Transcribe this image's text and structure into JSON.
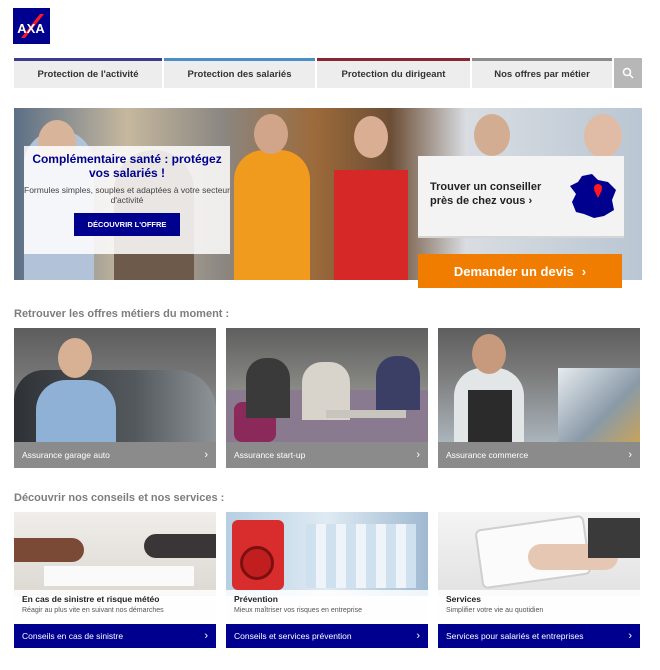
{
  "brand": {
    "logo_text": "AXA",
    "color": "#00008f",
    "accent": "#f07c00"
  },
  "nav": {
    "items": [
      {
        "label": "Protection de l'activité"
      },
      {
        "label": "Protection des salariés"
      },
      {
        "label": "Protection du dirigeant"
      },
      {
        "label": "Nos offres par métier"
      }
    ],
    "search_icon": "search-icon"
  },
  "hero": {
    "promo": {
      "title": "Complémentaire santé : protégez vos salariés !",
      "text": "Formules simples, souples et adaptées à votre secteur d'activité",
      "button": "DÉCOUVRIR L'OFFRE"
    },
    "advisor": {
      "text": "Trouver un conseiller près de chez vous",
      "chevron": "›"
    },
    "quote_button": "Demander un devis",
    "quote_chevron": "›"
  },
  "offers": {
    "title": "Retrouver les offres métiers du moment :",
    "cards": [
      {
        "label": "Assurance garage auto"
      },
      {
        "label": "Assurance start-up"
      },
      {
        "label": "Assurance commerce"
      }
    ]
  },
  "services": {
    "title": "Découvrir nos conseils et nos services :",
    "cards": [
      {
        "caption_title": "En cas de sinistre et risque météo",
        "caption_sub": "Réagir au plus vite en suivant nos démarches",
        "link": "Conseils en cas de sinistre"
      },
      {
        "caption_title": "Prévention",
        "caption_sub": "Mieux maîtriser vos risques en entreprise",
        "link": "Conseils et services prévention"
      },
      {
        "caption_title": "Services",
        "caption_sub": "Simplifier votre vie au quotidien",
        "link": "Services pour salariés et entreprises"
      }
    ]
  }
}
